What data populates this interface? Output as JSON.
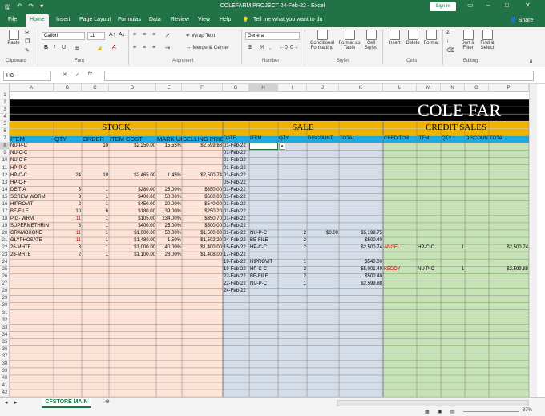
{
  "window": {
    "title": "COLEFARM PROJECT 24-Feb-22  -  Excel",
    "sign_in": "Sign in",
    "share": "Share"
  },
  "tabs": [
    "File",
    "Home",
    "Insert",
    "Page Layout",
    "Formulas",
    "Data",
    "Review",
    "View",
    "Help"
  ],
  "tell_me": "Tell me what you want to do",
  "ribbon": {
    "groups": [
      "Clipboard",
      "Font",
      "Alignment",
      "Number",
      "Styles",
      "Cells",
      "Editing"
    ],
    "paste": "Paste",
    "font_name": "Calibri",
    "font_size": "11",
    "wrap_text": "Wrap Text",
    "merge_center": "Merge & Center",
    "number_format": "General",
    "conditional_formatting": "Conditional Formatting",
    "format_as_table": "Format as Table",
    "cell_styles": "Cell Styles",
    "insert": "Insert",
    "delete": "Delete",
    "format": "Format",
    "sort_filter": "Sort & Filter",
    "find_select": "Find & Select"
  },
  "formula_bar": {
    "name_box": "H8",
    "fx": "fx",
    "content": ""
  },
  "columns": [
    "A",
    "B",
    "C",
    "D",
    "E",
    "F",
    "G",
    "H",
    "I",
    "J",
    "K",
    "L",
    "M",
    "N",
    "O",
    "P"
  ],
  "rows": [
    "1",
    "2",
    "3",
    "4",
    "5",
    "6",
    "7",
    "8",
    "9",
    "10",
    "11",
    "12",
    "13",
    "14",
    "15",
    "16",
    "17",
    "18",
    "19",
    "20",
    "21",
    "22",
    "23",
    "24",
    "25",
    "26",
    "27",
    "28",
    "29",
    "30",
    "31",
    "32",
    "33",
    "34",
    "35",
    "36",
    "37",
    "38",
    "39",
    "40",
    "41",
    "42"
  ],
  "banner": "COLE FAR",
  "sections": {
    "stock": "STOCK",
    "sale": "SALE",
    "credit": "CREDIT SALES"
  },
  "headers": {
    "stock": [
      "ITEM",
      "QTY",
      "ORDER",
      "ITEM COST",
      "MARK UP",
      "SELLING PRICE"
    ],
    "sale": [
      "DATE",
      "ITEM",
      "QTY",
      "DISCOUNT",
      "TOTAL"
    ],
    "credit": [
      "CREDITOR",
      "ITEM",
      "QTY",
      "DISCOUNT",
      "TOTAL"
    ]
  },
  "stock_rows": [
    {
      "item": "NU-P-C",
      "qty": "",
      "order": "10",
      "cost": "$2,250.00",
      "markup": "15.55%",
      "price": "$2,599.88"
    },
    {
      "item": "NU-C-C",
      "qty": "",
      "order": "",
      "cost": "",
      "markup": "",
      "price": ""
    },
    {
      "item": "NU-C-F",
      "qty": "",
      "order": "",
      "cost": "",
      "markup": "",
      "price": ""
    },
    {
      "item": "HP-P-C",
      "qty": "",
      "order": "",
      "cost": "",
      "markup": "",
      "price": ""
    },
    {
      "item": "HP-C-C",
      "qty": "24",
      "order": "10",
      "cost": "$2,465.00",
      "markup": "1.45%",
      "price": "$2,500.74"
    },
    {
      "item": "HP-C-F",
      "qty": "",
      "order": "",
      "cost": "",
      "markup": "",
      "price": ""
    },
    {
      "item": "DEITIA",
      "qty": "3",
      "order": "1",
      "cost": "$280.00",
      "markup": "25.00%",
      "price": "$350.00"
    },
    {
      "item": "SCREW WORM",
      "qty": "3",
      "order": "1",
      "cost": "$400.00",
      "markup": "50.00%",
      "price": "$600.00"
    },
    {
      "item": "HIPROVIT",
      "qty": "2",
      "order": "1",
      "cost": "$450.00",
      "markup": "20.00%",
      "price": "$540.00"
    },
    {
      "item": "BE-FILE",
      "qty": "10",
      "order": "6",
      "cost": "$180.00",
      "markup": "39.00%",
      "price": "$250.20"
    },
    {
      "item": "PIG- WRM",
      "qty": "11",
      "order": "1",
      "cost": "$105.00",
      "markup": "234.00%",
      "price": "$350.70"
    },
    {
      "item": "SUPERMETHRIN",
      "qty": "3",
      "order": "1",
      "cost": "$400.00",
      "markup": "25.00%",
      "price": "$500.00"
    },
    {
      "item": "GRAMOXONE",
      "qty": "11",
      "order": "1",
      "cost": "$1,000.00",
      "markup": "50.00%",
      "price": "$1,500.00"
    },
    {
      "item": "GLYPHOSATE",
      "qty": "11",
      "order": "1",
      "cost": "$1,480.00",
      "markup": "1.50%",
      "price": "$1,502.20"
    },
    {
      "item": "26-MHTE",
      "qty": "3",
      "order": "1",
      "cost": "$1,000.00",
      "markup": "40.00%",
      "price": "$1,400.00"
    },
    {
      "item": "28-MHTE",
      "qty": "2",
      "order": "1",
      "cost": "$1,100.00",
      "markup": "28.00%",
      "price": "$1,408.00"
    }
  ],
  "sale_rows": [
    {
      "date": "01-Feb-22",
      "item": "",
      "qty": "",
      "discount": "",
      "total": ""
    },
    {
      "date": "01-Feb-22",
      "item": "",
      "qty": "",
      "discount": "",
      "total": ""
    },
    {
      "date": "01-Feb-22",
      "item": "",
      "qty": "",
      "discount": "",
      "total": ""
    },
    {
      "date": "01-Feb-22",
      "item": "",
      "qty": "",
      "discount": "",
      "total": ""
    },
    {
      "date": "01-Feb-22",
      "item": "",
      "qty": "",
      "discount": "",
      "total": ""
    },
    {
      "date": "05-Feb-22",
      "item": "",
      "qty": "",
      "discount": "",
      "total": ""
    },
    {
      "date": "01-Feb-22",
      "item": "",
      "qty": "",
      "discount": "",
      "total": ""
    },
    {
      "date": "01-Feb-22",
      "item": "",
      "qty": "",
      "discount": "",
      "total": ""
    },
    {
      "date": "01-Feb-22",
      "item": "",
      "qty": "",
      "discount": "",
      "total": ""
    },
    {
      "date": "01-Feb-22",
      "item": "",
      "qty": "",
      "discount": "",
      "total": ""
    },
    {
      "date": "01-Feb-22",
      "item": "",
      "qty": "",
      "discount": "",
      "total": ""
    },
    {
      "date": "01-Feb-22",
      "item": "",
      "qty": "",
      "discount": "",
      "total": ""
    },
    {
      "date": "01-Feb-22",
      "item": "NU-P-C",
      "qty": "2",
      "discount": "$0.00",
      "total": "$5,199.75"
    },
    {
      "date": "04-Feb-22",
      "item": "BE-FILE",
      "qty": "2",
      "discount": "",
      "total": "$500.40"
    },
    {
      "date": "15-Feb-22",
      "item": "HP-C-C",
      "qty": "2",
      "discount": "",
      "total": "$2,500.74"
    },
    {
      "date": "17-Feb-22",
      "item": "",
      "qty": "",
      "discount": "",
      "total": ""
    },
    {
      "date": "19-Feb-22",
      "item": "HIPROVIT",
      "qty": "1",
      "discount": "",
      "total": "$540.00"
    },
    {
      "date": "19-Feb-22",
      "item": "HP-C-C",
      "qty": "2",
      "discount": "",
      "total": "$5,001.49"
    },
    {
      "date": "22-Feb-22",
      "item": "BE-FILE",
      "qty": "2",
      "discount": "",
      "total": "$500.40"
    },
    {
      "date": "22-Feb-22",
      "item": "NU-P-C",
      "qty": "1",
      "discount": "",
      "total": "$2,599.88"
    },
    {
      "date": "24-Feb-22",
      "item": "",
      "qty": "",
      "discount": "",
      "total": ""
    }
  ],
  "credit_rows": [
    {
      "row": 22,
      "creditor": "ANGEL",
      "item": "HP-C-C",
      "qty": "1",
      "total": "$2,500.74"
    },
    {
      "row": 25,
      "creditor": "KEDDY",
      "item": "NU-P-C",
      "qty": "1",
      "total": "$2,599.88"
    }
  ],
  "sheet_tab": "CFSTORE MAIN",
  "zoom": "87%",
  "colors": {
    "excel_green": "#217346",
    "section_orange": "#f0b400",
    "header_blue": "#1fa9e1",
    "stock_fill": "#fde3d6",
    "sale_fill": "#d5dde8",
    "credit_fill": "#c6e3b5"
  }
}
